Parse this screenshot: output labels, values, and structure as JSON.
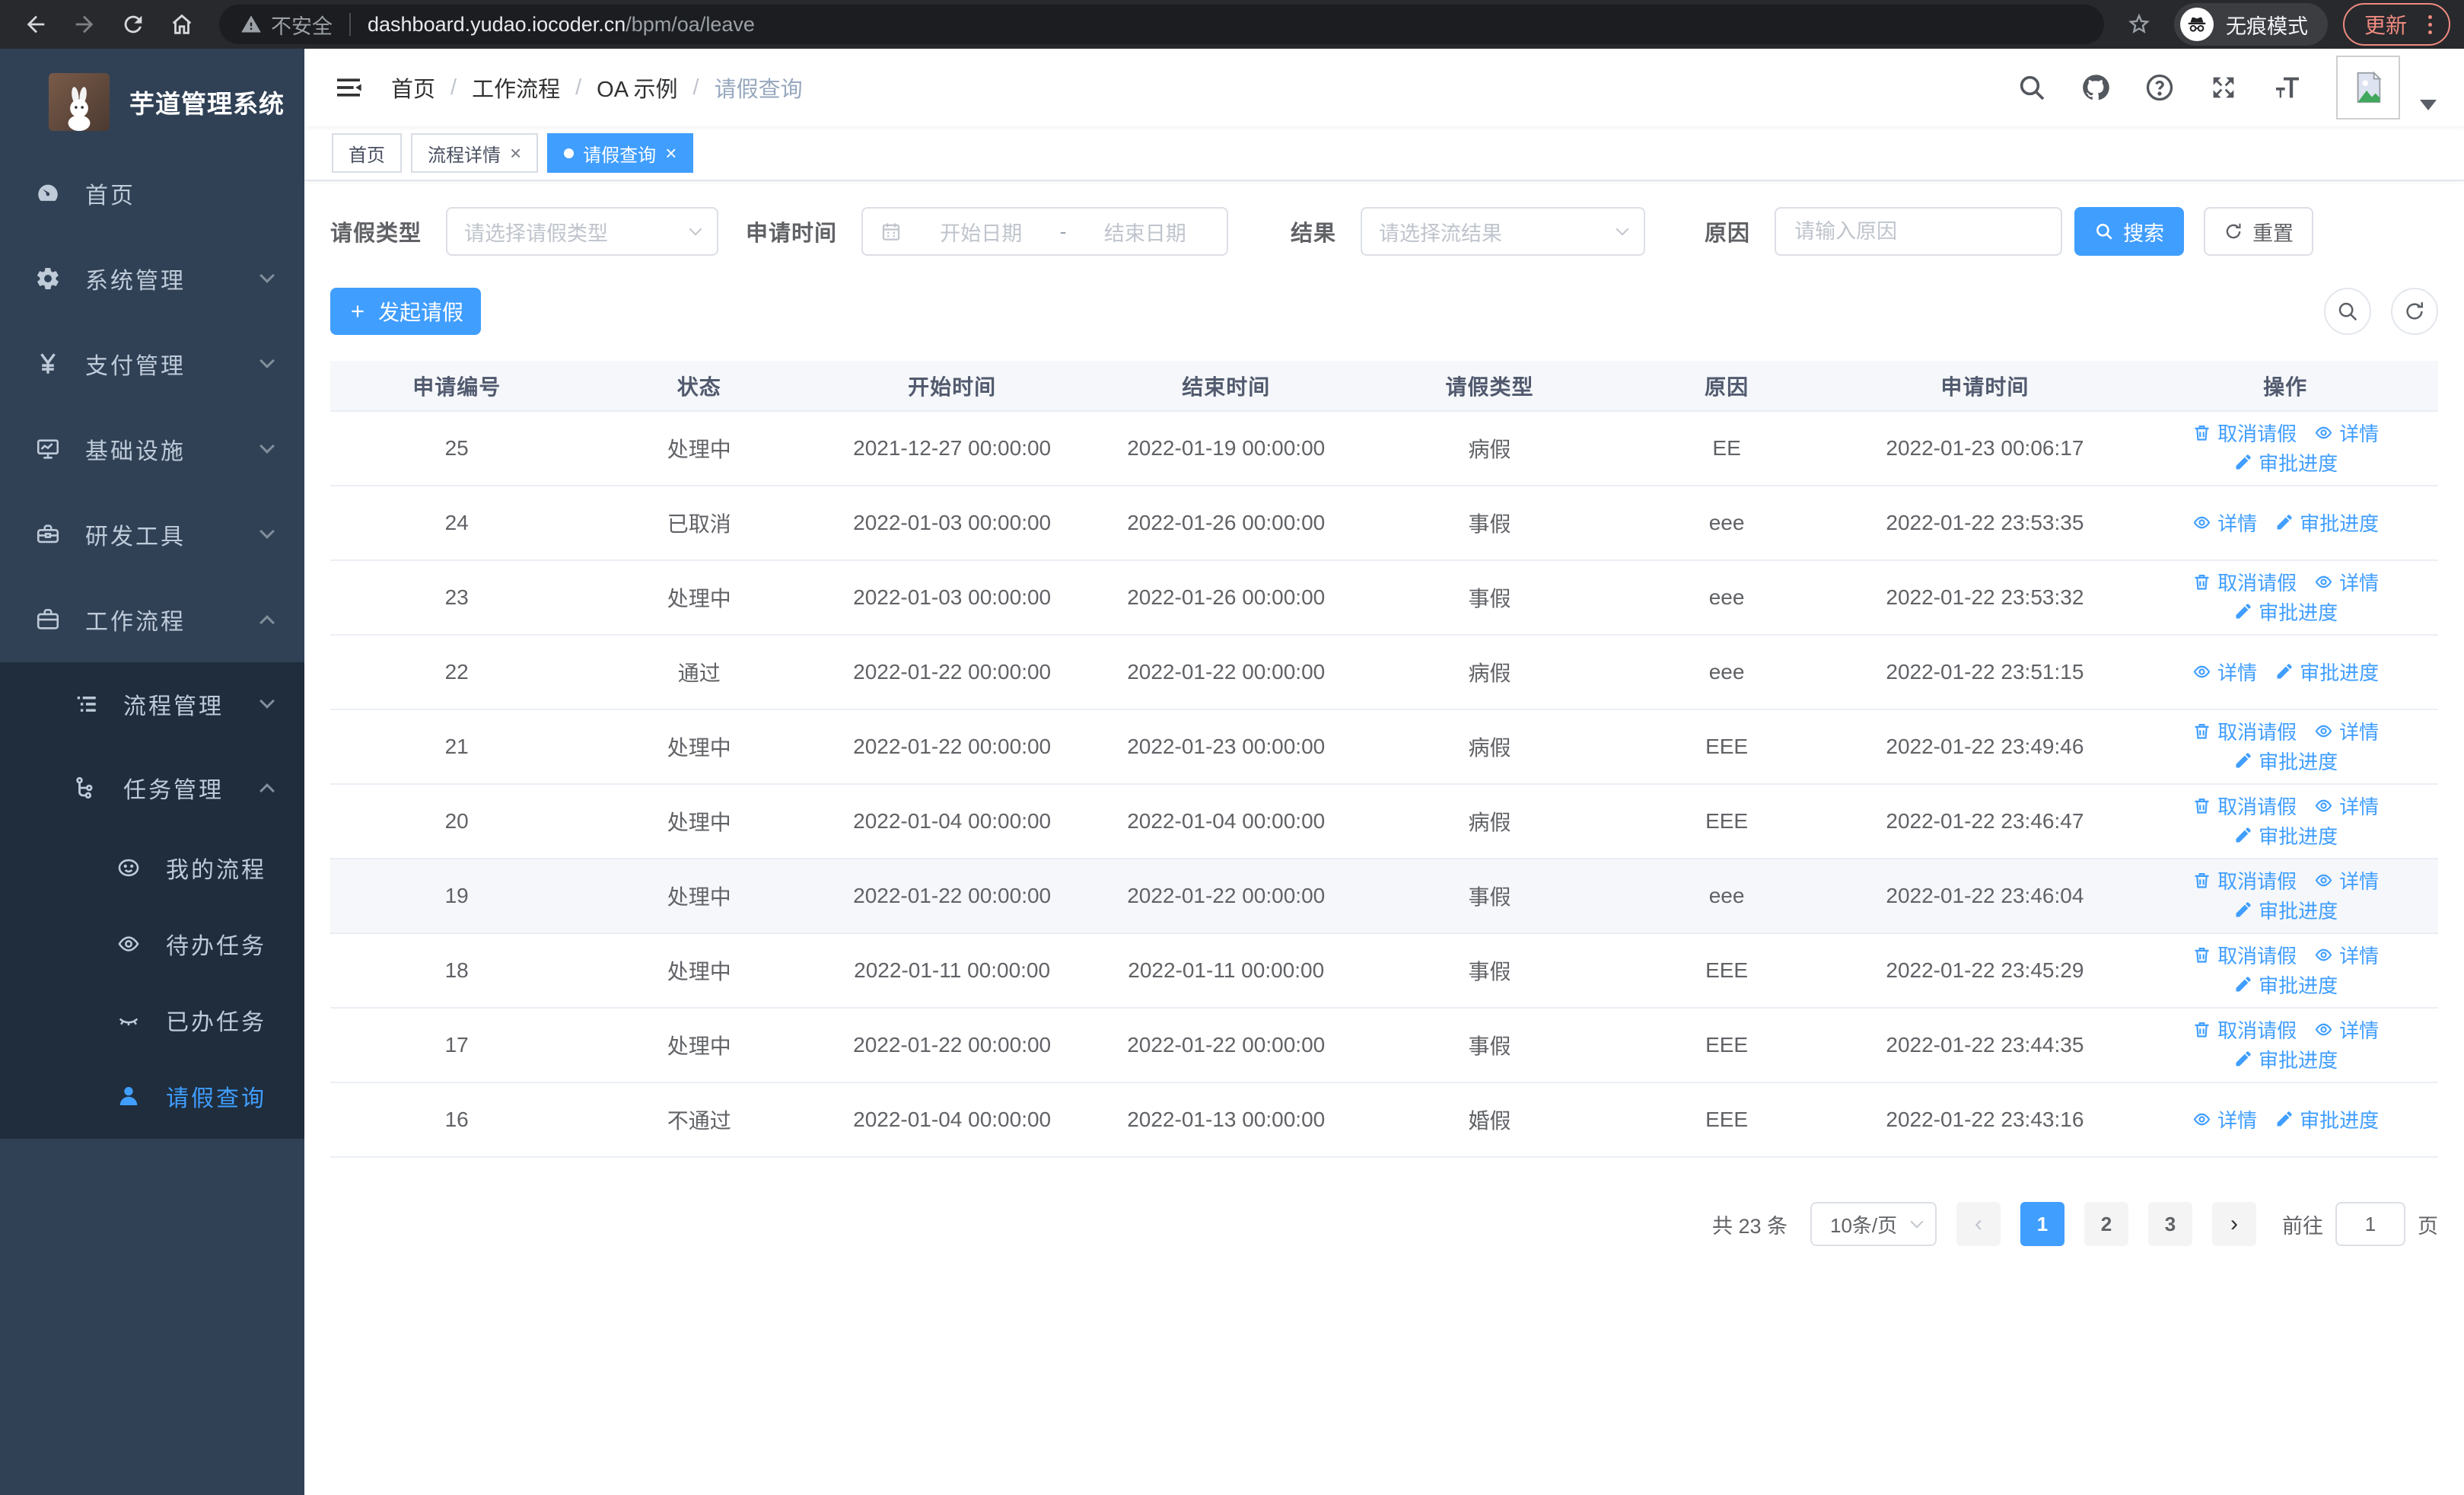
{
  "colors": {
    "primary": "#409EFF",
    "sidebar_bg": "#304156",
    "submenu_bg": "#1F2D3D",
    "update_accent": "#EE8A7F"
  },
  "browser": {
    "security_label": "不安全",
    "url_host": "dashboard.yudao.iocoder.cn",
    "url_path": "/bpm/oa/leave",
    "incognito_label": "无痕模式",
    "update_label": "更新"
  },
  "sidebar": {
    "title": "芋道管理系统",
    "items": [
      {
        "label": "首页",
        "icon": "dashboard-icon"
      },
      {
        "label": "系统管理",
        "icon": "gear-icon"
      },
      {
        "label": "支付管理",
        "icon": "yen-icon"
      },
      {
        "label": "基础设施",
        "icon": "monitor-icon"
      },
      {
        "label": "研发工具",
        "icon": "toolbox-icon"
      },
      {
        "label": "工作流程",
        "icon": "briefcase-icon"
      }
    ],
    "submenu": [
      {
        "label": "流程管理",
        "icon": "list-icon"
      },
      {
        "label": "任务管理",
        "icon": "tree-icon"
      }
    ],
    "tasks": [
      {
        "label": "我的流程",
        "icon": "face-icon"
      },
      {
        "label": "待办任务",
        "icon": "eye-icon"
      },
      {
        "label": "已办任务",
        "icon": "eye-closed-icon"
      },
      {
        "label": "请假查询",
        "icon": "user-icon"
      }
    ]
  },
  "header": {
    "breadcrumb": [
      "首页",
      "工作流程",
      "OA 示例",
      "请假查询"
    ]
  },
  "tabs": [
    {
      "label": "首页"
    },
    {
      "label": "流程详情"
    },
    {
      "label": "请假查询"
    }
  ],
  "filters": {
    "leave_type_label": "请假类型",
    "leave_type_placeholder": "请选择请假类型",
    "apply_time_label": "申请时间",
    "date_start_placeholder": "开始日期",
    "date_separator": "-",
    "date_end_placeholder": "结束日期",
    "result_label": "结果",
    "result_placeholder": "请选择流结果",
    "reason_label": "原因",
    "reason_placeholder": "请输入原因",
    "search_label": "搜索",
    "reset_label": "重置"
  },
  "toolbar": {
    "create_label": "发起请假"
  },
  "table": {
    "columns": [
      "申请编号",
      "状态",
      "开始时间",
      "结束时间",
      "请假类型",
      "原因",
      "申请时间",
      "操作"
    ],
    "action_labels": {
      "cancel": "取消请假",
      "detail": "详情",
      "progress": "审批进度"
    },
    "rows": [
      {
        "id": "25",
        "status": "处理中",
        "start": "2021-12-27 00:00:00",
        "end": "2022-01-19 00:00:00",
        "type": "病假",
        "reason": "EE",
        "apply_time": "2022-01-23 00:06:17",
        "actions": [
          "cancel",
          "detail",
          "progress"
        ],
        "highlighted": false
      },
      {
        "id": "24",
        "status": "已取消",
        "start": "2022-01-03 00:00:00",
        "end": "2022-01-26 00:00:00",
        "type": "事假",
        "reason": "eee",
        "apply_time": "2022-01-22 23:53:35",
        "actions": [
          "detail",
          "progress"
        ],
        "highlighted": false
      },
      {
        "id": "23",
        "status": "处理中",
        "start": "2022-01-03 00:00:00",
        "end": "2022-01-26 00:00:00",
        "type": "事假",
        "reason": "eee",
        "apply_time": "2022-01-22 23:53:32",
        "actions": [
          "cancel",
          "detail",
          "progress"
        ],
        "highlighted": false
      },
      {
        "id": "22",
        "status": "通过",
        "start": "2022-01-22 00:00:00",
        "end": "2022-01-22 00:00:00",
        "type": "病假",
        "reason": "eee",
        "apply_time": "2022-01-22 23:51:15",
        "actions": [
          "detail",
          "progress"
        ],
        "highlighted": false
      },
      {
        "id": "21",
        "status": "处理中",
        "start": "2022-01-22 00:00:00",
        "end": "2022-01-23 00:00:00",
        "type": "病假",
        "reason": "EEE",
        "apply_time": "2022-01-22 23:49:46",
        "actions": [
          "cancel",
          "detail",
          "progress"
        ],
        "highlighted": false
      },
      {
        "id": "20",
        "status": "处理中",
        "start": "2022-01-04 00:00:00",
        "end": "2022-01-04 00:00:00",
        "type": "病假",
        "reason": "EEE",
        "apply_time": "2022-01-22 23:46:47",
        "actions": [
          "cancel",
          "detail",
          "progress"
        ],
        "highlighted": false
      },
      {
        "id": "19",
        "status": "处理中",
        "start": "2022-01-22 00:00:00",
        "end": "2022-01-22 00:00:00",
        "type": "事假",
        "reason": "eee",
        "apply_time": "2022-01-22 23:46:04",
        "actions": [
          "cancel",
          "detail",
          "progress"
        ],
        "highlighted": true
      },
      {
        "id": "18",
        "status": "处理中",
        "start": "2022-01-11 00:00:00",
        "end": "2022-01-11 00:00:00",
        "type": "事假",
        "reason": "EEE",
        "apply_time": "2022-01-22 23:45:29",
        "actions": [
          "cancel",
          "detail",
          "progress"
        ],
        "highlighted": false
      },
      {
        "id": "17",
        "status": "处理中",
        "start": "2022-01-22 00:00:00",
        "end": "2022-01-22 00:00:00",
        "type": "事假",
        "reason": "EEE",
        "apply_time": "2022-01-22 23:44:35",
        "actions": [
          "cancel",
          "detail",
          "progress"
        ],
        "highlighted": false
      },
      {
        "id": "16",
        "status": "不通过",
        "start": "2022-01-04 00:00:00",
        "end": "2022-01-13 00:00:00",
        "type": "婚假",
        "reason": "EEE",
        "apply_time": "2022-01-22 23:43:16",
        "actions": [
          "detail",
          "progress"
        ],
        "highlighted": false
      }
    ]
  },
  "pagination": {
    "total_text": "共 23 条",
    "page_size_value": "10条/页",
    "pages": [
      "1",
      "2",
      "3"
    ],
    "active_page": "1",
    "goto_label": "前往",
    "goto_value": "1",
    "page_suffix": "页"
  }
}
